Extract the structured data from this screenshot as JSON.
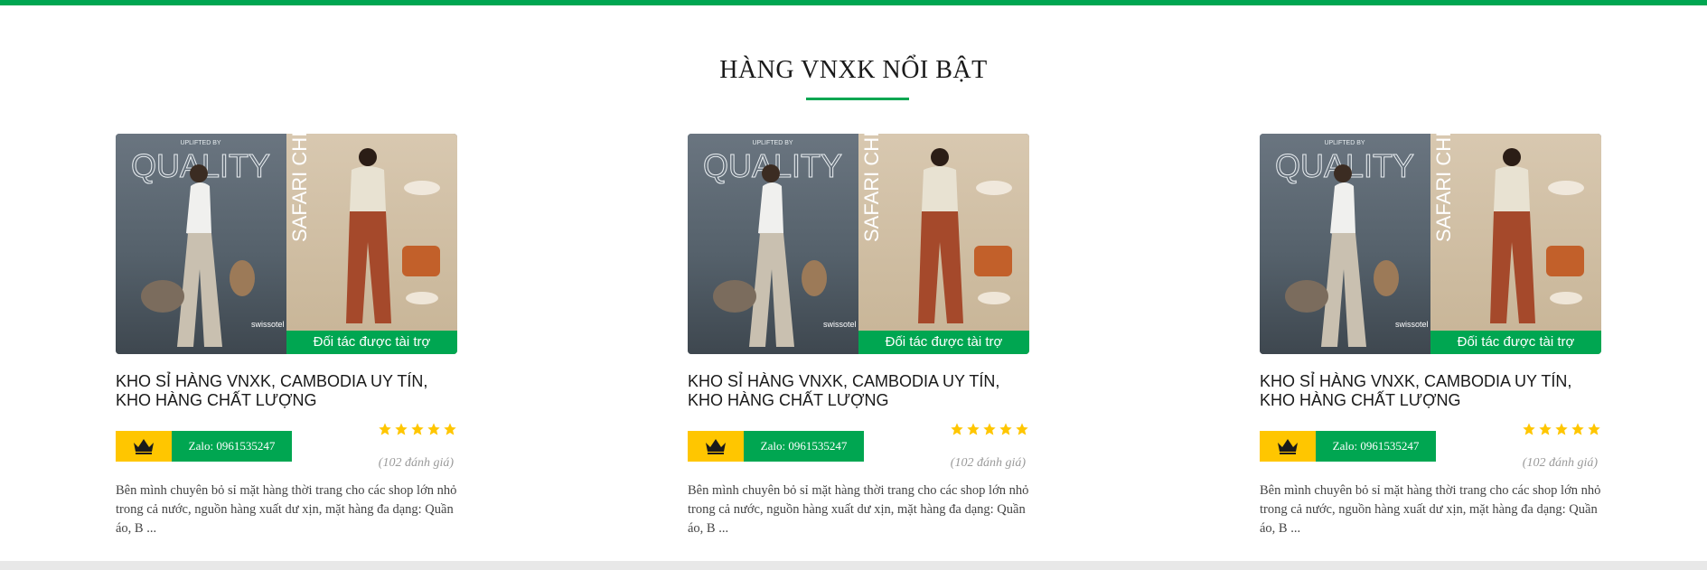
{
  "section": {
    "title": "HÀNG VNXK NỔI BẬT"
  },
  "colors": {
    "accent": "#00a651",
    "crown_badge": "#ffc600",
    "star": "#ffc600"
  },
  "cards": [
    {
      "image_alt": "Quality fashion ad with Safari Chic panel",
      "image_text": {
        "left_heading": "QUALITY",
        "left_top": "UPLIFTED BY",
        "left_brand": "swissotel",
        "right_heading": "SAFARI CHIC"
      },
      "sponsor_label": "Đối tác được tài trợ",
      "title": "KHO SỈ HÀNG VNXK, CAMBODIA UY TÍN, KHO HÀNG CHẤT LƯỢNG",
      "rating": 5,
      "zalo_label": "Zalo: 0961535247",
      "review_count": "(102 đánh giá)",
      "description": "Bên mình chuyên bỏ sỉ mặt hàng thời trang cho các shop lớn nhỏ trong cả nước, nguồn hàng xuất dư xịn, mặt hàng đa dạng: Quần áo, B ..."
    },
    {
      "image_alt": "Quality fashion ad with Safari Chic panel",
      "image_text": {
        "left_heading": "QUALITY",
        "left_top": "UPLIFTED BY",
        "left_brand": "swissotel",
        "right_heading": "SAFARI CHIC"
      },
      "sponsor_label": "Đối tác được tài trợ",
      "title": "KHO SỈ HÀNG VNXK, CAMBODIA UY TÍN, KHO HÀNG CHẤT LƯỢNG",
      "rating": 5,
      "zalo_label": "Zalo: 0961535247",
      "review_count": "(102 đánh giá)",
      "description": "Bên mình chuyên bỏ sỉ mặt hàng thời trang cho các shop lớn nhỏ trong cả nước, nguồn hàng xuất dư xịn, mặt hàng đa dạng: Quần áo, B ..."
    },
    {
      "image_alt": "Quality fashion ad with Safari Chic panel",
      "image_text": {
        "left_heading": "QUALITY",
        "left_top": "UPLIFTED BY",
        "left_brand": "swissotel",
        "right_heading": "SAFARI CHIC"
      },
      "sponsor_label": "Đối tác được tài trợ",
      "title": "KHO SỈ HÀNG VNXK, CAMBODIA UY TÍN, KHO HÀNG CHẤT LƯỢNG",
      "rating": 5,
      "zalo_label": "Zalo: 0961535247",
      "review_count": "(102 đánh giá)",
      "description": "Bên mình chuyên bỏ sỉ mặt hàng thời trang cho các shop lớn nhỏ trong cả nước, nguồn hàng xuất dư xịn, mặt hàng đa dạng: Quần áo, B ..."
    }
  ]
}
